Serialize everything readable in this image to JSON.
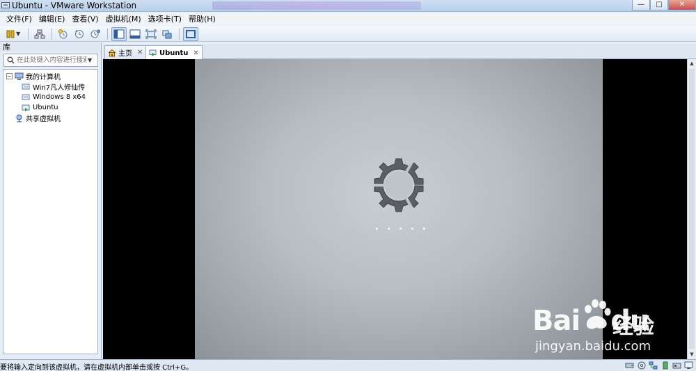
{
  "window": {
    "title": "Ubuntu - VMware Workstation",
    "minimize_label": "—",
    "maximize_label": "□",
    "close_label": "✕"
  },
  "menu": [
    {
      "label": "文件(F)"
    },
    {
      "label": "编辑(E)"
    },
    {
      "label": "查看(V)"
    },
    {
      "label": "虚拟机(M)"
    },
    {
      "label": "选项卡(T)"
    },
    {
      "label": "帮助(H)"
    }
  ],
  "toolbar": {
    "icons": [
      "power-icon",
      "snapshot-network-icon",
      "snapshot-take-icon",
      "snapshot-revert-icon",
      "snapshot-manager-icon",
      "library-view-icon",
      "thumbnail-bar-icon",
      "fullscreen-icon",
      "unity-icon",
      "console-view-icon"
    ]
  },
  "library": {
    "title": "库",
    "search_placeholder": "在此处键入内容进行搜索",
    "tree": {
      "root": {
        "label": "我的计算机",
        "expander": "⊟"
      },
      "vms": [
        {
          "label": "Win7凡人修仙传",
          "running": false
        },
        {
          "label": "Windows 8 x64",
          "running": false
        },
        {
          "label": "Ubuntu",
          "running": true
        }
      ],
      "shared": {
        "label": "共享虚拟机"
      }
    }
  },
  "tabs": [
    {
      "label": "主页",
      "active": false,
      "close": "✕"
    },
    {
      "label": "Ubuntu",
      "active": true,
      "close": "✕"
    }
  ],
  "vm_screen": {
    "loading_dots": 5
  },
  "watermark": {
    "brand": "Bai",
    "brand2": "du",
    "cn": "经验",
    "url": "jingyan.baidu.com"
  },
  "statusbar": {
    "message": "要将输入定向到该虚拟机，请在虚拟机内部单击或按 Ctrl+G。"
  },
  "colors": {
    "accent": "#3c7fc4",
    "running": "#2aa13c"
  }
}
